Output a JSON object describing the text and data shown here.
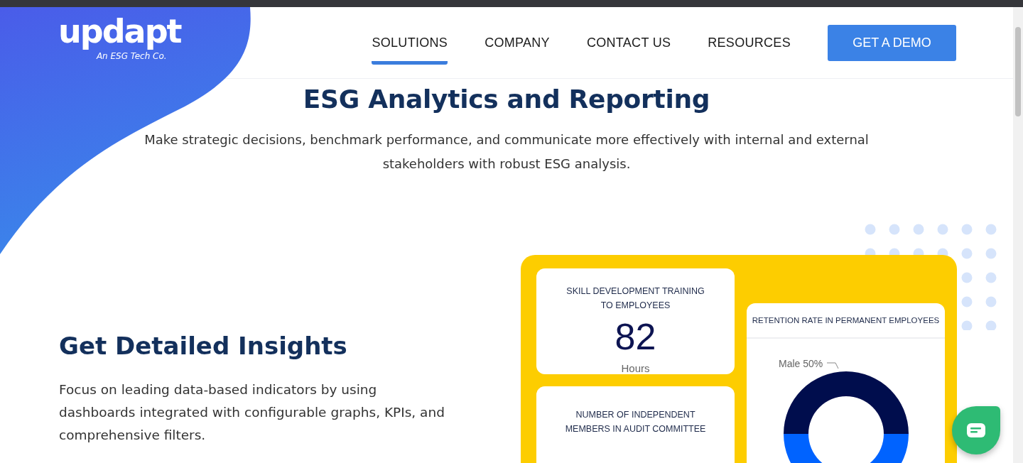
{
  "logo": {
    "wordmark": "updapt",
    "tagline": "An ESG Tech Co."
  },
  "nav": {
    "items": [
      {
        "label": "SOLUTIONS",
        "selected": true
      },
      {
        "label": "COMPANY",
        "selected": false
      },
      {
        "label": "CONTACT US",
        "selected": false
      },
      {
        "label": "RESOURCES",
        "selected": false
      }
    ],
    "cta": "GET A DEMO"
  },
  "hero": {
    "title": "ESG Analytics and Reporting",
    "subtitle": "Make strategic decisions, benchmark performance, and communicate more effectively with internal and external stakeholders with robust ESG analysis."
  },
  "insights": {
    "title": "Get Detailed Insights",
    "body": "Focus on leading data-based indicators by using dashboards integrated with configurable graphs, KPIs, and comprehensive filters."
  },
  "dashboard": {
    "kpi_cards": [
      {
        "title": "SKILL DEVELOPMENT TRAINING TO EMPLOYEES",
        "value": "82",
        "unit": "Hours"
      },
      {
        "title": "NUMBER OF INDEPENDENT MEMBERS IN AUDIT COMMITTEE"
      }
    ],
    "retention_card": {
      "title": "RETENTION RATE IN PERMANENT EMPLOYEES",
      "slice_label": "Male 50%"
    }
  }
}
